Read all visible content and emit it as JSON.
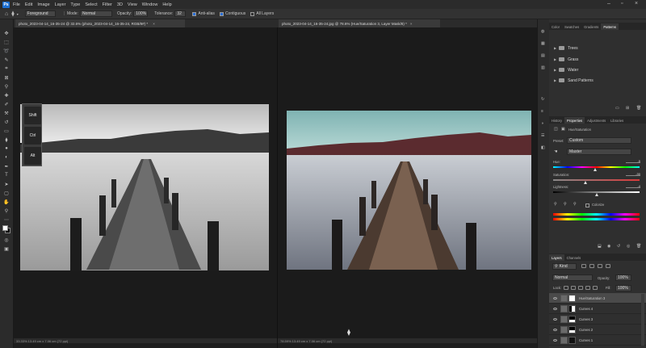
{
  "menubar": {
    "logo": "Ps",
    "items": [
      "File",
      "Edit",
      "Image",
      "Layer",
      "Type",
      "Select",
      "Filter",
      "3D",
      "View",
      "Window",
      "Help"
    ],
    "window_controls": [
      "–",
      "▫",
      "×"
    ]
  },
  "options": {
    "sample_label": "Foreground",
    "mode_label": "Mode:",
    "mode_value": "Normal",
    "opacity_label": "Opacity:",
    "opacity_value": "100%",
    "tolerance_label": "Tolerance:",
    "tolerance_value": "32",
    "antialias_label": "Anti-alias",
    "contiguous_label": "Contiguous",
    "all_layers_label": "All Layers"
  },
  "documents": [
    {
      "tab_title": "photo_2023-04-14_16-35-24 @ 32.6% (photo_2023-04-14_16-35-24, RGB/8#) *",
      "status": "33.33% 13.49 cm x 7.06 cm (72 ppi)"
    },
    {
      "tab_title": "photo_2023-04-14_16-35-24.jpg @ 78.6% (Hue/Saturation 3, Layer Mask/8) *",
      "status": "78.59% 13.49 cm x 7.06 cm (72 ppi)"
    }
  ],
  "shortcut_keys": [
    "Shift",
    "Ctrl",
    "Alt"
  ],
  "swatches_panel": {
    "tabs": [
      "Color",
      "Swatches",
      "Gradients",
      "Patterns"
    ],
    "active_tab": "Patterns",
    "folders": [
      "Trees",
      "Grass",
      "Water",
      "Sand Patterns"
    ]
  },
  "properties_panel": {
    "tabs": [
      "History",
      "Properties",
      "Adjustments",
      "Libraries"
    ],
    "active_tab": "Properties",
    "title": "Hue/Saturation",
    "preset_label": "Preset:",
    "preset_value": "Custom",
    "channel_value": "Master",
    "hue_label": "Hue:",
    "hue_value": "-5",
    "saturation_label": "Saturation:",
    "saturation_value": "-30",
    "lightness_label": "Lightness:",
    "lightness_value": "-4",
    "colorize_label": "Colorize"
  },
  "layers_panel": {
    "tabs": [
      "Layers",
      "Channels"
    ],
    "active_tab": "Layers",
    "filter_label": "Kind",
    "blend_mode": "Normal",
    "opacity_label": "Opacity:",
    "opacity_value": "100%",
    "lock_label": "Lock:",
    "fill_label": "Fill:",
    "fill_value": "100%",
    "layers": [
      {
        "name": "Hue/Saturation 3",
        "selected": true
      },
      {
        "name": "Curves 4",
        "selected": false
      },
      {
        "name": "Curves 3",
        "selected": false
      },
      {
        "name": "Curves 2",
        "selected": false
      },
      {
        "name": "Curves 1",
        "selected": false
      }
    ]
  },
  "colors": {
    "accent": "#2a6fd6",
    "ps_blue": "#1c6fd1",
    "sky_tint": "#8fc2c0",
    "hills_tint": "#5b2b2f"
  }
}
